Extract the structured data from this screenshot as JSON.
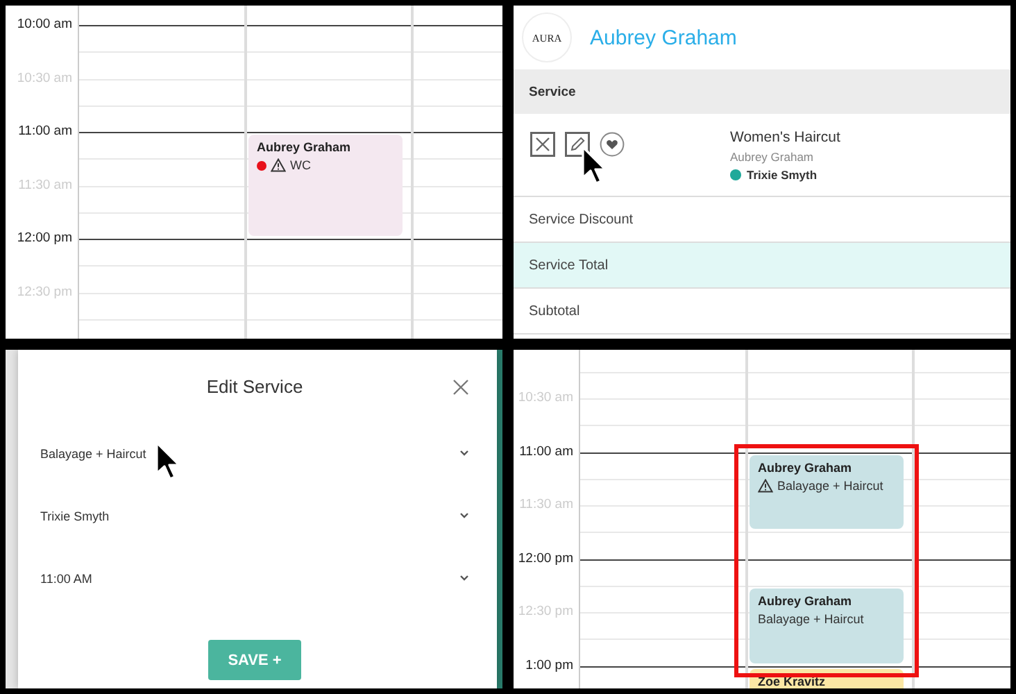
{
  "calendar_top": {
    "time_labels": [
      {
        "text": "10:00 am",
        "major": true
      },
      {
        "text": "10:30 am",
        "major": false
      },
      {
        "text": "11:00 am",
        "major": true
      },
      {
        "text": "11:30 am",
        "major": false
      },
      {
        "text": "12:00 pm",
        "major": true
      },
      {
        "text": "12:30 pm",
        "major": false
      }
    ],
    "events": [
      {
        "title": "Aubrey Graham",
        "detail": "WC",
        "warning": true,
        "color": "#f4e8f0"
      }
    ]
  },
  "checkout": {
    "logo": "AURA",
    "client_name": "Aubrey Graham",
    "section_header": "Service",
    "service": {
      "name": "Women's Haircut",
      "client": "Aubrey Graham",
      "stylist": "Trixie Smyth"
    },
    "rows": [
      {
        "label": "Service Discount",
        "highlighted": false
      },
      {
        "label": "Service Total",
        "highlighted": true
      },
      {
        "label": "Subtotal",
        "highlighted": false
      }
    ]
  },
  "edit_service_dialog": {
    "title": "Edit Service",
    "fields": [
      {
        "value": "Balayage + Haircut"
      },
      {
        "value": "Trixie Smyth"
      },
      {
        "value": "11:00 AM"
      }
    ],
    "save_button": "SAVE +"
  },
  "calendar_bottom": {
    "time_labels": [
      {
        "text": "10:30 am",
        "major": false
      },
      {
        "text": "11:00 am",
        "major": true
      },
      {
        "text": "11:30 am",
        "major": false
      },
      {
        "text": "12:00 pm",
        "major": true
      },
      {
        "text": "12:30 pm",
        "major": false
      },
      {
        "text": "1:00 pm",
        "major": true
      }
    ],
    "events": [
      {
        "title": "Aubrey Graham",
        "detail": "Balayage + Haircut",
        "warning": true,
        "color": "#c9e2e5"
      },
      {
        "title": "Aubrey Graham",
        "detail": "Balayage + Haircut",
        "warning": false,
        "color": "#c9e2e5"
      },
      {
        "title": "Zoe Kravitz",
        "color": "#fbe7a4"
      }
    ],
    "highlight_box": true
  }
}
